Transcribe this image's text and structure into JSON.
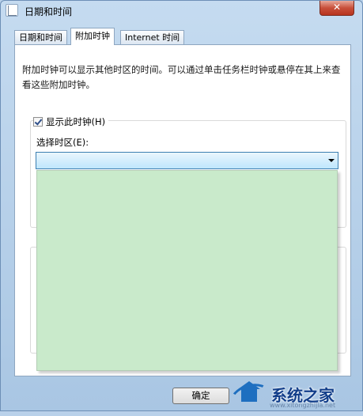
{
  "window": {
    "title": "日期和时间",
    "close_label": "✕"
  },
  "tabs": [
    {
      "label": "日期和时间",
      "active": false
    },
    {
      "label": "附加时钟",
      "active": true
    },
    {
      "label": "Internet 时间",
      "active": false
    }
  ],
  "panel": {
    "description": "附加时钟可以显示其他时区的时间。可以通过单击任务栏时钟或悬停在其上来查看这些附加时钟。",
    "clock1": {
      "show_label": "显示此时钟(H)",
      "show_checked": true,
      "timezone_label": "选择时区(E):",
      "timezone_value": ""
    }
  },
  "footer": {
    "ok_label": "确定"
  },
  "watermark": {
    "text": "系统之家",
    "url": "www.xitongzhijia.net"
  },
  "colors": {
    "dropdown_list_bg": "#c9eacb",
    "dropdown_border": "#3c7fb1",
    "brand_blue": "#123e8a"
  }
}
